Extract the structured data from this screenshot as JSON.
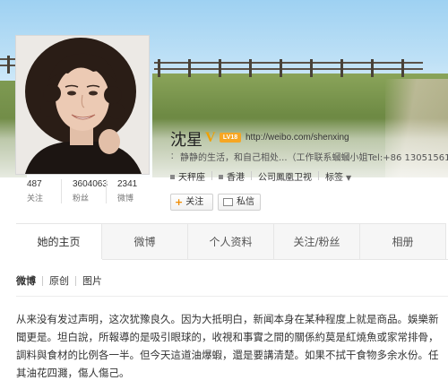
{
  "profile": {
    "name": "沈星",
    "verified_badge": "V",
    "level_badge": "LV18",
    "url": "http://weibo.com/shenxing",
    "bio_quote": "：",
    "bio": "静静的生活，和自己相处...（工作联系蟈蟈小姐Tel:+86 13051561",
    "tags": [
      {
        "label": "天秤座"
      },
      {
        "label": "香港"
      },
      {
        "label": "公司鳳凰卫视"
      },
      {
        "label": "标签",
        "arrow": "▼"
      }
    ]
  },
  "stats": [
    {
      "value": "487",
      "label": "关注"
    },
    {
      "value": "3604063",
      "label": "粉丝"
    },
    {
      "value": "2341",
      "label": "微博"
    }
  ],
  "buttons": {
    "follow_plus": "+",
    "follow_label": "关注",
    "message_label": "私信"
  },
  "tabs": [
    {
      "label": "她的主页",
      "active": true
    },
    {
      "label": "微博"
    },
    {
      "label": "个人资料"
    },
    {
      "label": "关注/粉丝"
    },
    {
      "label": "相册"
    }
  ],
  "subnav": [
    "微博",
    "原创",
    "图片"
  ],
  "post": {
    "text": "从来没有发过声明，这次犹豫良久。因为大抵明白，新闻本身在某种程度上就是商品。娛樂新聞更是。坦白說，所報導的是吸引眼球的，收視和事實之間的關係約莫是紅燒魚或家常排骨，調料與食材的比例各一半。但今天這道油爆蝦，還是要講清楚。如果不拭干食物多余水份。任其油花四濺，傷人傷己。"
  },
  "colors": {
    "accent_orange": "#f0a000",
    "sky": "#9ed1f2",
    "grass": "#6e8a44"
  }
}
